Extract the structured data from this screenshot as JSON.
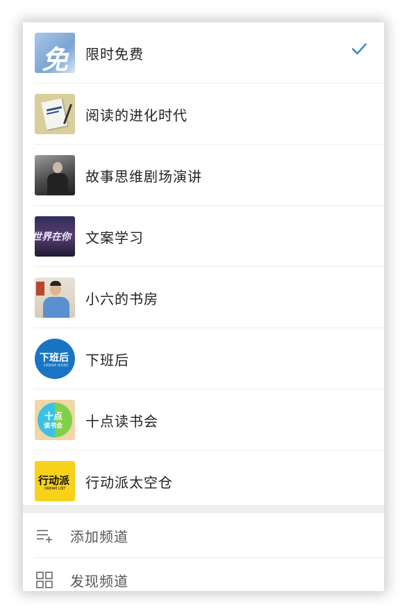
{
  "channels": [
    {
      "label": "限时免费",
      "thumb_icon": "free-calligraphy-icon",
      "selected": true
    },
    {
      "label": "阅读的进化时代",
      "thumb_icon": "book-cover-icon",
      "selected": false
    },
    {
      "label": "故事思维剧场演讲",
      "thumb_icon": "speaker-photo-icon",
      "selected": false
    },
    {
      "label": "文案学习",
      "thumb_icon": "world-text-icon",
      "selected": false
    },
    {
      "label": "小六的书房",
      "thumb_icon": "person-photo-icon",
      "selected": false
    },
    {
      "label": "下班后",
      "thumb_icon": "after-work-logo-icon",
      "selected": false
    },
    {
      "label": "十点读书会",
      "thumb_icon": "ten-reading-logo-icon",
      "selected": false
    },
    {
      "label": "行动派太空仓",
      "thumb_icon": "action-logo-icon",
      "selected": false
    }
  ],
  "thumb_texts": {
    "free": "免",
    "world": "世界在你",
    "after_work": "下班后",
    "after_work_sub": "DREAM WORK",
    "ten_top": "十点",
    "ten_bottom": "读书会",
    "action": "行动派",
    "action_sub": "DREAM LIST"
  },
  "actions": [
    {
      "label": "添加频道",
      "icon": "add-list-icon"
    },
    {
      "label": "发现频道",
      "icon": "grid-icon"
    }
  ],
  "colors": {
    "accent_check": "#2a7fd1",
    "after_work_blue": "#1a74c4",
    "action_yellow": "#f8d21a"
  }
}
